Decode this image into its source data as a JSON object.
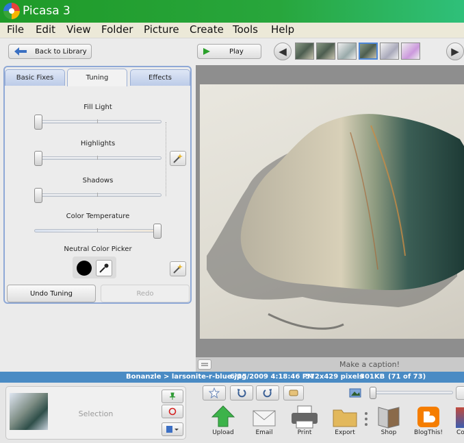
{
  "app": {
    "title": "Picasa 3"
  },
  "menu": [
    "File",
    "Edit",
    "View",
    "Folder",
    "Picture",
    "Create",
    "Tools",
    "Help"
  ],
  "toolbar": {
    "back_label": "Back to Library",
    "play_label": "Play"
  },
  "tabs": [
    {
      "label": "Basic Fixes"
    },
    {
      "label": "Tuning"
    },
    {
      "label": "Effects"
    }
  ],
  "tuning": {
    "fill_light": {
      "label": "Fill Light",
      "value": 0
    },
    "highlights": {
      "label": "Highlights",
      "value": 0
    },
    "shadows": {
      "label": "Shadows",
      "value": 0
    },
    "color_temperature": {
      "label": "Color Temperature",
      "value": 1
    },
    "neutral_label": "Neutral Color Picker",
    "undo_label": "Undo Tuning",
    "redo_label": "Redo"
  },
  "caption": {
    "placeholder": "Make a caption!"
  },
  "status": {
    "path": "Bonanzle > larsonite-r-blue.jpg",
    "datetime": "6/25/2009 4:18:46 PM",
    "dimensions": "572x429 pixels",
    "size": "301KB",
    "position": "(71 of 73)"
  },
  "tray": {
    "label": "Selection"
  },
  "zoom": {
    "value": 0
  },
  "actions": [
    {
      "label": "Upload",
      "icon": "upload-icon"
    },
    {
      "label": "Email",
      "icon": "email-icon"
    },
    {
      "label": "Print",
      "icon": "print-icon"
    },
    {
      "label": "Export",
      "icon": "export-icon"
    },
    {
      "label": "Shop",
      "icon": "shop-icon"
    },
    {
      "label": "BlogThis!",
      "icon": "blogger-icon"
    },
    {
      "label": "Co",
      "icon": "collage-icon"
    }
  ],
  "colors": {
    "titlebar": "#1f9a28",
    "status_bar": "#4a8bc4",
    "tab_border": "#8ea8d6"
  }
}
